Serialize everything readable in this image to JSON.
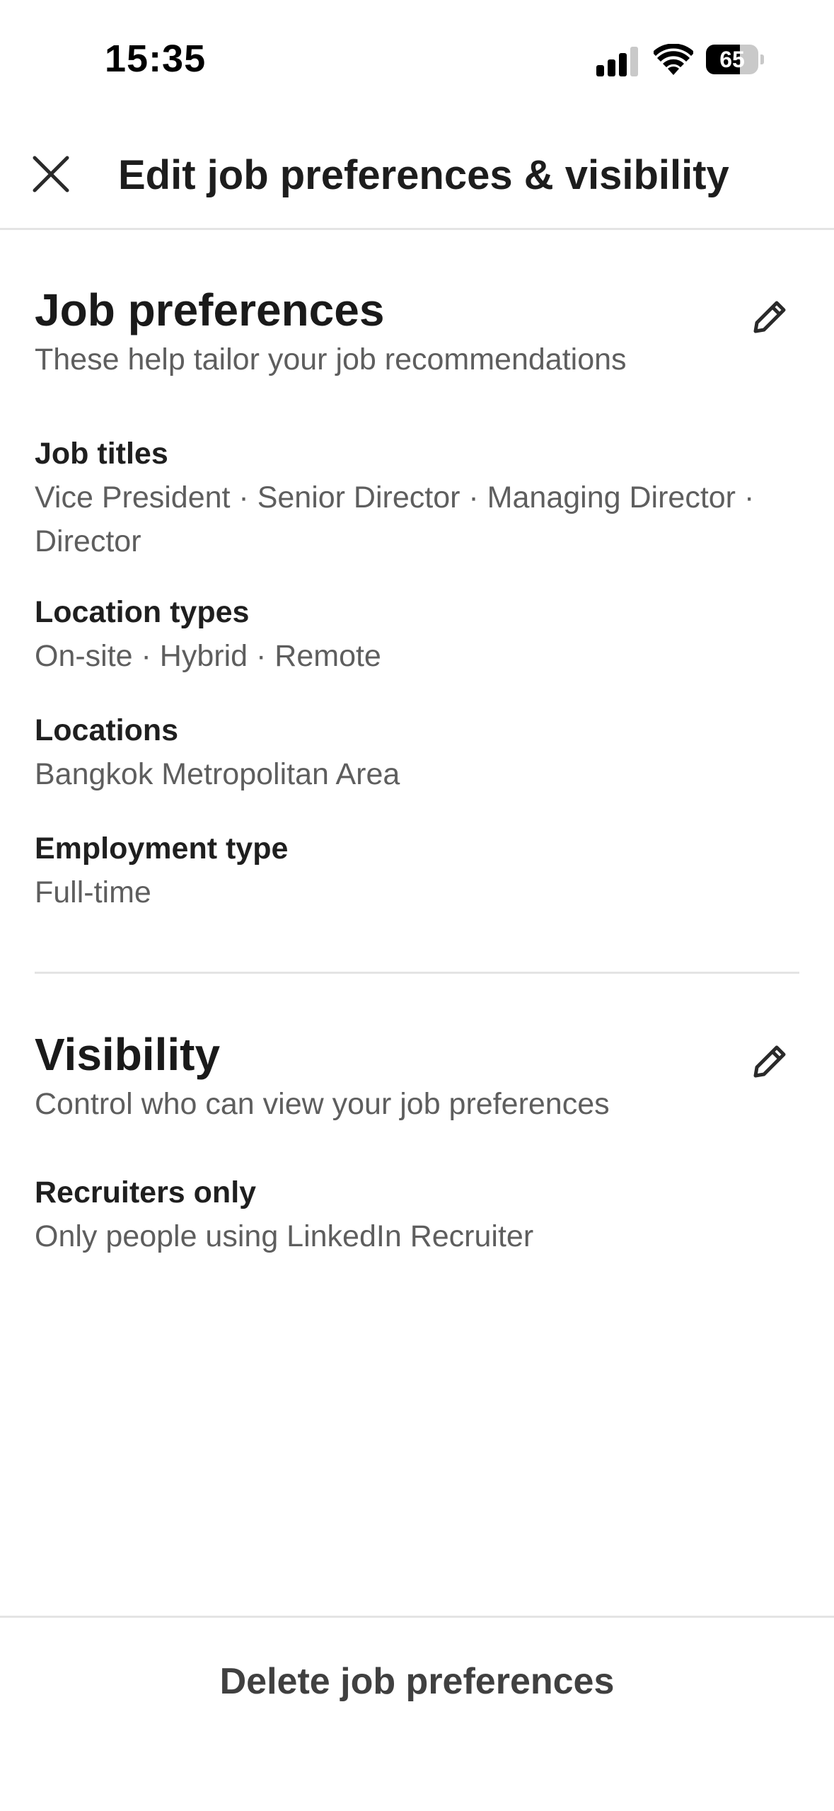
{
  "status_bar": {
    "time": "15:35",
    "battery_level": "65",
    "battery_fraction": 0.65,
    "icons": [
      "signal-icon",
      "wifi-icon",
      "battery-icon"
    ]
  },
  "header": {
    "title": "Edit job preferences & visibility",
    "close_icon": "close-icon"
  },
  "job_preferences": {
    "title": "Job preferences",
    "subtitle": "These help tailor your job recommendations",
    "edit_icon": "pencil-icon",
    "fields": [
      {
        "label": "Job titles",
        "value": "Vice President · Senior Director · Managing Director · Director"
      },
      {
        "label": "Location types",
        "value": "On-site · Hybrid · Remote"
      },
      {
        "label": "Locations",
        "value": "Bangkok Metropolitan Area"
      },
      {
        "label": "Employment type",
        "value": "Full-time"
      }
    ]
  },
  "visibility": {
    "title": "Visibility",
    "subtitle": "Control who can view your job preferences",
    "edit_icon": "pencil-icon",
    "fields": [
      {
        "label": "Recruiters only",
        "value": "Only people using LinkedIn Recruiter"
      }
    ]
  },
  "footer": {
    "delete_label": "Delete job preferences"
  },
  "colors": {
    "text_primary": "#1f1f1f",
    "text_secondary": "#5e5e5e",
    "divider": "#e4e4e4",
    "background": "#ffffff"
  }
}
